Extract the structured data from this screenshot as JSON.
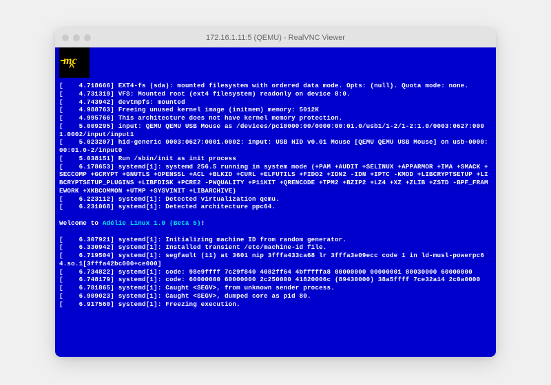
{
  "window": {
    "title": "172.16.1.11:5 (QEMU) - RealVNC Viewer"
  },
  "logo": {
    "text": "mc",
    "caret": "^"
  },
  "welcome": {
    "prefix": "Welcome to ",
    "distro": "Adélie Linux 1.0 (Beta 5)",
    "suffix": "!"
  },
  "lines": [
    "[    4.718666] EXT4-fs (sda): mounted filesystem with ordered data mode. Opts: (null). Quota mode: none.",
    "[    4.731319] VFS: Mounted root (ext4 filesystem) readonly on device 8:0.",
    "[    4.743942] devtmpfs: mounted",
    "[    4.988763] Freeing unused kernel image (initmem) memory: 5012K",
    "[    4.995766] This architecture does not have kernel memory protection.",
    "[    5.009295] input: QEMU QEMU USB Mouse as /devices/pci0000:00/0000:00:01.0/usb1/1-2/1-2:1.0/0003:0627:0001.0002/input/input1",
    "[    5.023207] hid-generic 0003:0627:0001.0002: input: USB HID v0.01 Mouse [QEMU QEMU USB Mouse] on usb-0000:00:01.0-2/input0",
    "[    5.038151] Run /sbin/init as init process",
    "[    6.178653] systemd[1]: systemd 256.5 running in system mode (+PAM +AUDIT +SELINUX +APPARMOR +IMA +SMACK +SECCOMP +GCRYPT +GNUTLS +OPENSSL +ACL +BLKID +CURL +ELFUTILS +FIDO2 +IDN2 -IDN +IPTC -KMOD +LIBCRYPTSETUP +LIBCRYPTSETUP_PLUGINS +LIBFDISK +PCRE2 -PWQUALITY +P11KIT +QRENCODE +TPM2 +BZIP2 +LZ4 +XZ +ZLIB +ZSTD -BPF_FRAMEWORK +XKBCOMMON +UTMP +SYSVINIT +LIBARCHIVE)",
    "[    6.223112] systemd[1]: Detected virtualization qemu.",
    "[    6.231068] systemd[1]: Detected architecture ppc64."
  ],
  "lines2": [
    "[    6.307921] systemd[1]: Initializing machine ID from random generator.",
    "[    6.330942] systemd[1]: Installed transient /etc/machine-id file.",
    "[    6.719504] systemd[1]: segfault (11) at 3601 nip 3fffa433ca68 lr 3fffa3e09ecc code 1 in ld-musl-powerpc64.so.1[3fffa42bc000+ce000]",
    "[    6.734822] systemd[1]: code: 98e9ffff 7c29f840 4082ff64 4bfffffa8 00000000 00000001 80030000 60000000",
    "[    6.748179] systemd[1]: code: 60000000 60000000 2c250000 41820006c (89430000) 38a5ffff 7ce32a14 2c0a0000",
    "[    6.781865] systemd[1]: Caught <SEGV>, from unknown sender process.",
    "[    6.909023] systemd[1]: Caught <SEGV>, dumped core as pid 80.",
    "[    6.917560] systemd[1]: Freezing execution."
  ]
}
